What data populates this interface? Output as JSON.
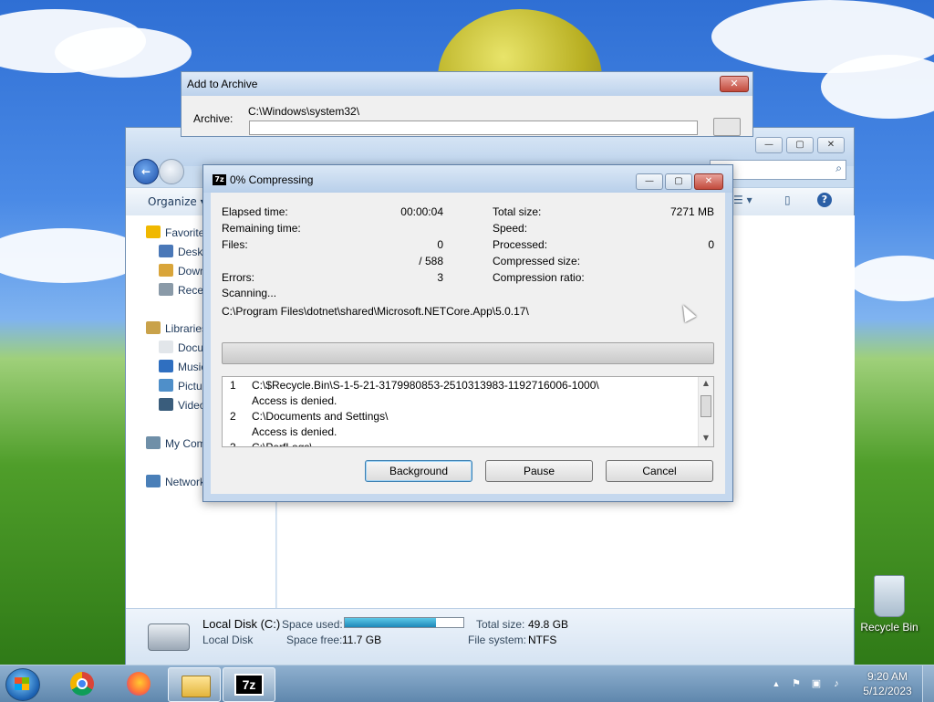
{
  "desktop": {
    "recycle_bin_label": "Recycle Bin"
  },
  "add_archive": {
    "title": "Add to Archive",
    "archive_label": "Archive:",
    "archive_path": "C:\\Windows\\system32\\",
    "close_glyph": "✕"
  },
  "explorer": {
    "organize_label": "Organize ▾",
    "sidebar": [
      {
        "label": "Favorites",
        "icon": "star-icon",
        "indent": false
      },
      {
        "label": "Desktop",
        "icon": "desktop-icon",
        "indent": true
      },
      {
        "label": "Downloads",
        "icon": "downloads-icon",
        "indent": true
      },
      {
        "label": "Recent Places",
        "icon": "recent-places-icon",
        "indent": true
      },
      {
        "label": "Libraries",
        "icon": "libraries-icon",
        "indent": false
      },
      {
        "label": "Documents",
        "icon": "documents-icon",
        "indent": true
      },
      {
        "label": "Music",
        "icon": "music-icon",
        "indent": true
      },
      {
        "label": "Pictures",
        "icon": "pictures-icon",
        "indent": true
      },
      {
        "label": "Videos",
        "icon": "videos-icon",
        "indent": true
      },
      {
        "label": "My Computer",
        "icon": "computer-icon",
        "indent": false
      },
      {
        "label": "Network",
        "icon": "network-icon",
        "indent": false
      }
    ],
    "details": {
      "name": "Local Disk (C:)",
      "type": "Local Disk",
      "space_used_label": "Space used:",
      "space_used_fraction": 0.77,
      "space_free_label": "Space free:",
      "space_free_value": "11.7 GB",
      "total_size_label": "Total size:",
      "total_size_value": "49.8 GB",
      "file_system_label": "File system:",
      "file_system_value": "NTFS"
    }
  },
  "progress_dialog": {
    "title": "0% Compressing",
    "icon_text": "7z",
    "stats_left": [
      {
        "label": "Elapsed time:",
        "value": "00:00:04"
      },
      {
        "label": "Remaining time:",
        "value": ""
      },
      {
        "label": "Files:",
        "value": "0"
      },
      {
        "label": "",
        "value": "/ 588"
      },
      {
        "label": "Errors:",
        "value": "3"
      }
    ],
    "stats_right": [
      {
        "label": "Total size:",
        "value": "7271 MB"
      },
      {
        "label": "Speed:",
        "value": ""
      },
      {
        "label": "Processed:",
        "value": "0"
      },
      {
        "label": "Compressed size:",
        "value": ""
      },
      {
        "label": "Compression ratio:",
        "value": ""
      }
    ],
    "status": "Scanning...",
    "current_path": "C:\\Program Files\\dotnet\\shared\\Microsoft.NETCore.App\\5.0.17\\",
    "progress_fraction": 0.0,
    "log": [
      {
        "num": "1",
        "text": "C:\\$Recycle.Bin\\S-1-5-21-3179980853-2510313983-1192716006-1000\\"
      },
      {
        "num": "",
        "text": "Access is denied."
      },
      {
        "num": "2",
        "text": "C:\\Documents and Settings\\"
      },
      {
        "num": "",
        "text": "Access is denied."
      },
      {
        "num": "3",
        "text": "C:\\PerfLogs\\"
      }
    ],
    "buttons": {
      "background": "Background",
      "pause": "Pause",
      "cancel": "Cancel"
    },
    "close_glyph": "✕",
    "min_glyph": "—",
    "max_glyph": "▢"
  },
  "taskbar": {
    "apps": [
      {
        "name": "chrome",
        "active": false
      },
      {
        "name": "firefox",
        "active": false
      },
      {
        "name": "file-explorer",
        "active": true
      },
      {
        "name": "7-zip",
        "active": true
      }
    ],
    "sevenz_text": "7z",
    "tray_up_glyph": "▲",
    "clock_time": "9:20 AM",
    "clock_date": "5/12/2023"
  },
  "colors": {
    "accent_blue": "#1d4fa8",
    "close_red": "#c24a3c",
    "progress_green": "#1fa21f"
  }
}
